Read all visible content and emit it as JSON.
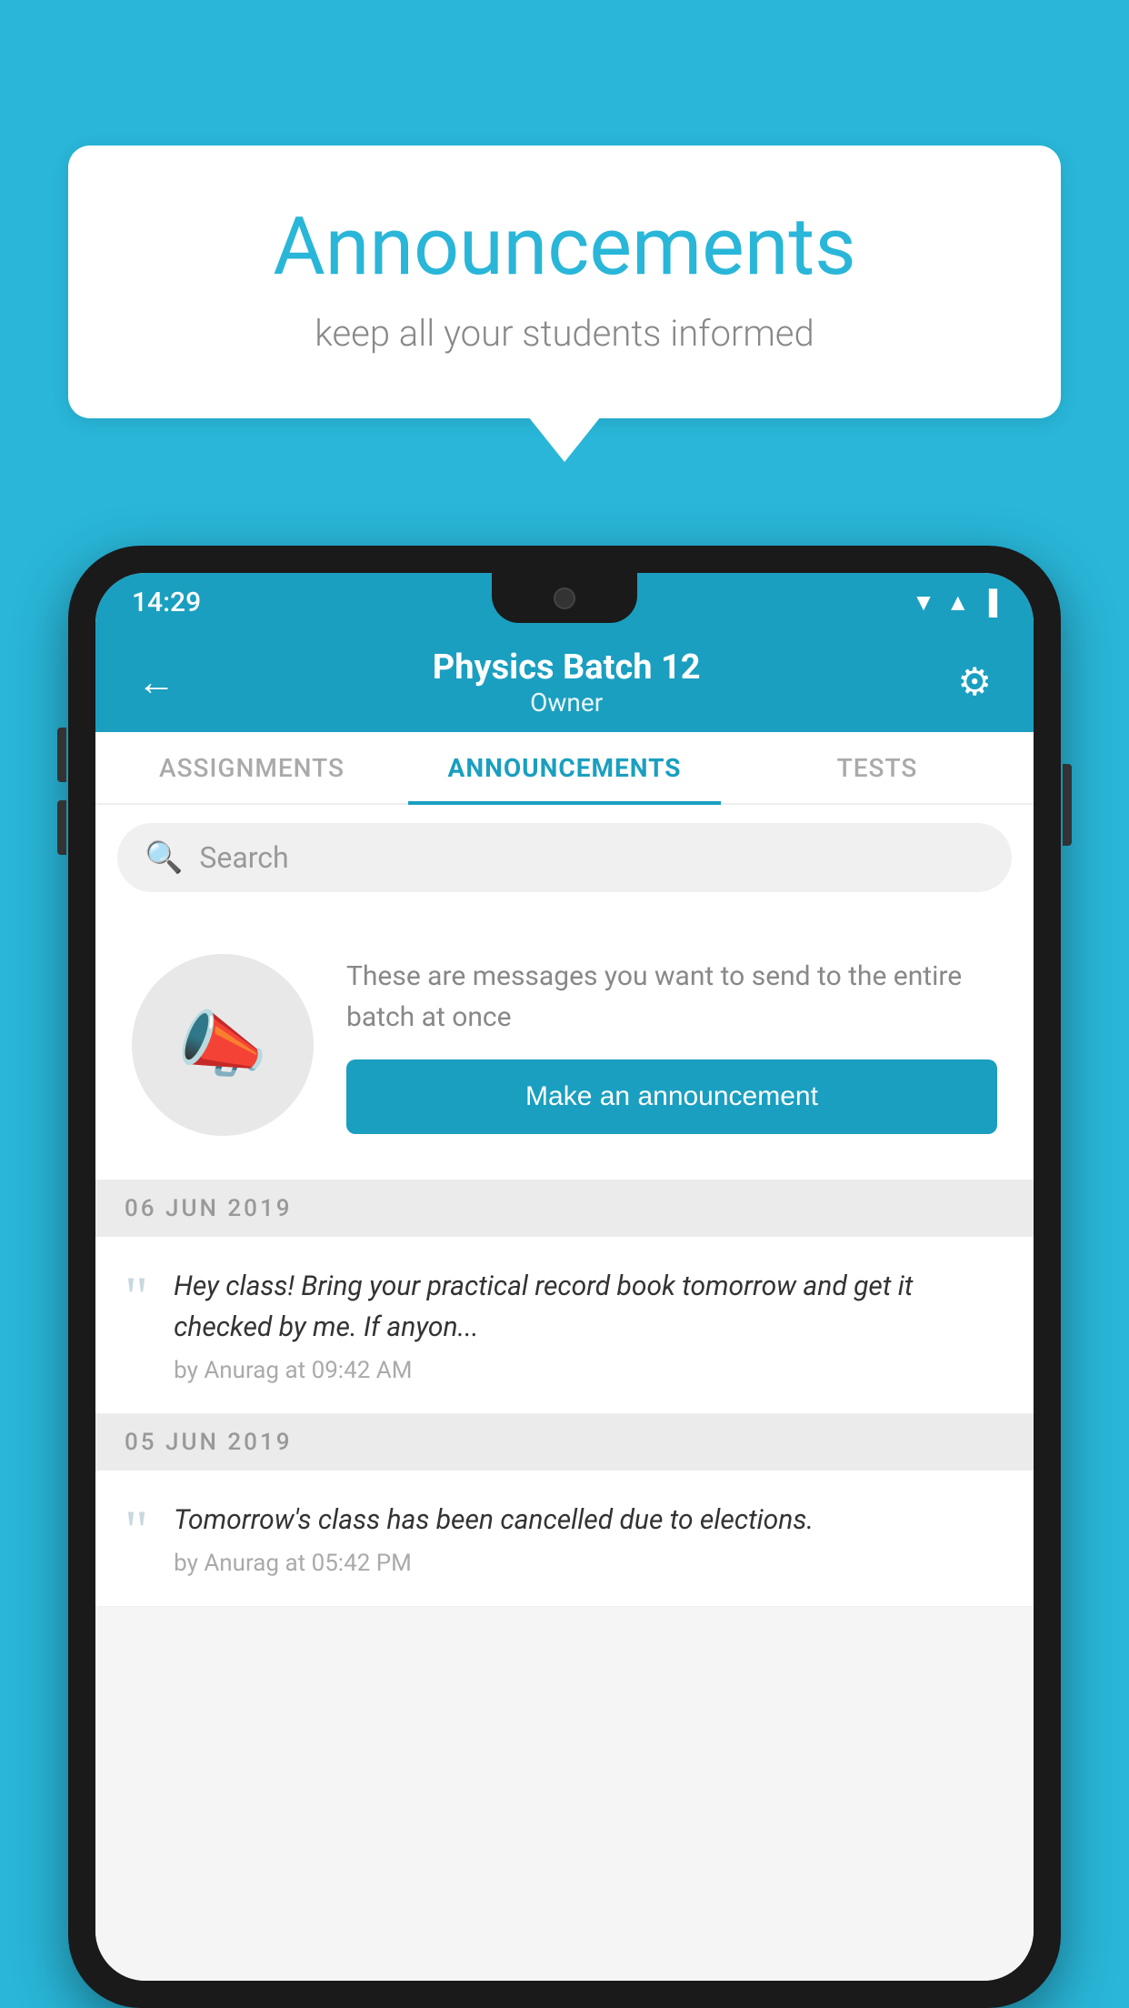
{
  "bubble": {
    "title": "Announcements",
    "subtitle": "keep all your students informed"
  },
  "phone": {
    "status_bar": {
      "time": "14:29"
    },
    "app_bar": {
      "title": "Physics Batch 12",
      "subtitle": "Owner",
      "back_label": "←",
      "gear_label": "⚙"
    },
    "tabs": [
      {
        "label": "ASSIGNMENTS",
        "active": false
      },
      {
        "label": "ANNOUNCEMENTS",
        "active": true
      },
      {
        "label": "TESTS",
        "active": false
      },
      {
        "label": "•",
        "active": false
      }
    ],
    "search": {
      "placeholder": "Search"
    },
    "promo": {
      "description": "These are messages you want to send to the entire batch at once",
      "button_label": "Make an announcement"
    },
    "announcements": [
      {
        "date": "06  JUN  2019",
        "text": "Hey class! Bring your practical record book tomorrow and get it checked by me. If anyon...",
        "meta": "by Anurag at 09:42 AM"
      },
      {
        "date": "05  JUN  2019",
        "text": "Tomorrow's class has been cancelled due to elections.",
        "meta": "by Anurag at 05:42 PM"
      }
    ]
  }
}
